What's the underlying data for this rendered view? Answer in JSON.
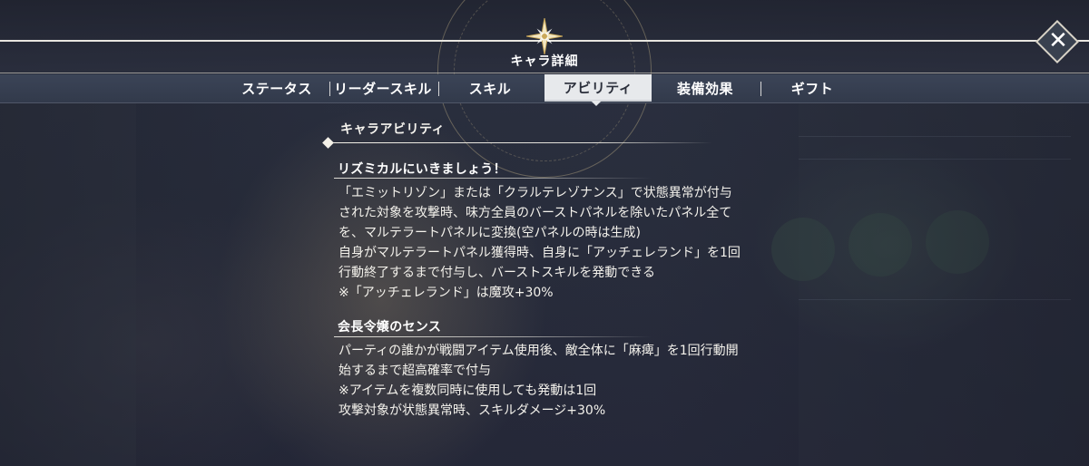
{
  "header": {
    "title": "キャラ詳細",
    "close_label": "✕",
    "emblem_icon": "compass-star-icon"
  },
  "tabs": [
    {
      "label": "ステータス",
      "active": false
    },
    {
      "label": "リーダースキル",
      "active": false
    },
    {
      "label": "スキル",
      "active": false
    },
    {
      "label": "アビリティ",
      "active": true
    },
    {
      "label": "装備効果",
      "active": false
    },
    {
      "label": "ギフト",
      "active": false
    }
  ],
  "content": {
    "section_title": "キャラアビリティ",
    "abilities": [
      {
        "name": "リズミカルにいきましょう！",
        "description": "「エミットリゾン」または「クラルテレゾナンス」で状態異常が付与\nされた対象を攻撃時、味方全員のバーストパネルを除いたパネル全て\nを、マルテラートパネルに変換(空パネルの時は生成)\n自身がマルテラートパネル獲得時、自身に「アッチェレランド」を1回\n行動終了するまで付与し、バーストスキルを発動できる\n※「アッチェレランド」は魔攻+30%"
      },
      {
        "name": "会長令嬢のセンス",
        "description": "パーティの誰かが戦闘アイテム使用後、敵全体に「麻痺」を1回行動開\n始するまで超高確率で付与\n※アイテムを複数同時に使用しても発動は1回\n攻撃対象が状態異常時、スキルダメージ+30%"
      }
    ]
  },
  "colors": {
    "tab_active_bg": "#e7e9ec",
    "tab_bar_bg": "#3b4457",
    "accent_gold": "#e8d9a8"
  }
}
